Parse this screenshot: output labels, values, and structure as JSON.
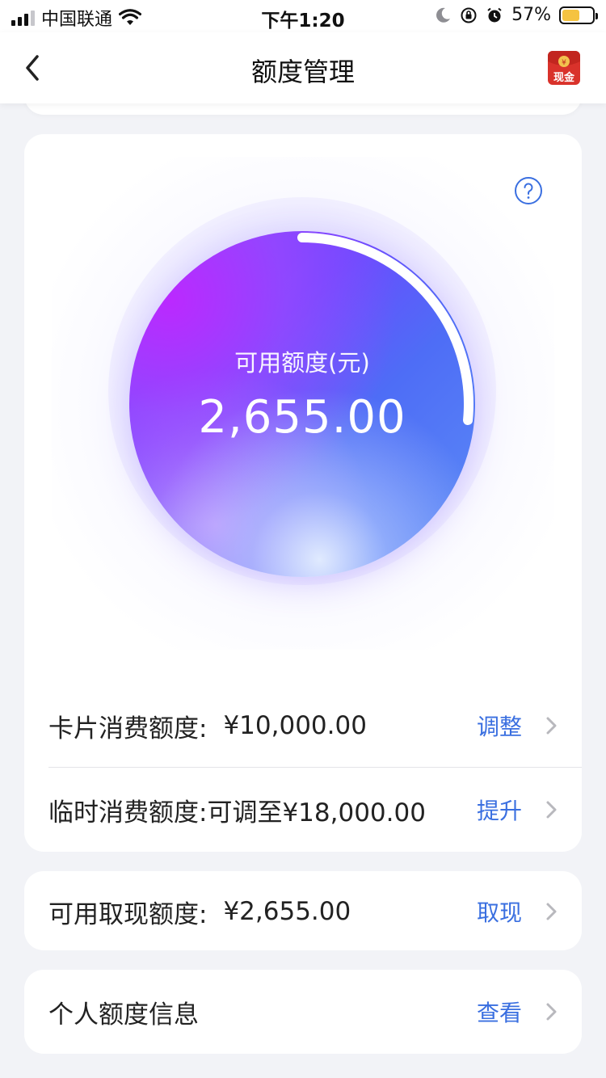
{
  "status_bar": {
    "carrier": "中国联通",
    "time": "下午1:20",
    "battery_percent": "57%",
    "battery_level": 0.57,
    "icons": [
      "signal-icon",
      "wifi-icon",
      "moon-icon",
      "orientation-lock-icon",
      "alarm-icon",
      "battery-icon"
    ]
  },
  "navbar": {
    "title": "额度管理",
    "back_icon": "chevron-left-icon",
    "cash_badge_label": "现金",
    "cash_badge_symbol": "¥"
  },
  "gauge": {
    "label": "可用额度(元)",
    "amount": "2,655.00",
    "help_icon": "question-circle-icon",
    "used_fraction": 0.2655,
    "colors": {
      "arc": "#ffffff",
      "help": "#3a6fe0"
    }
  },
  "limits": [
    {
      "label": "卡片消费额度:",
      "value": "¥10,000.00",
      "action": "调整"
    },
    {
      "label": "临时消费额度:",
      "value": "可调至¥18,000.00",
      "action": "提升"
    }
  ],
  "cash_limit": {
    "label": "可用取现额度:",
    "value": "¥2,655.00",
    "action": "取现"
  },
  "personal_info": {
    "label": "个人额度信息",
    "action": "查看"
  },
  "colors": {
    "accent": "#3a6fe0",
    "background": "#f2f3f7",
    "card": "#ffffff"
  }
}
